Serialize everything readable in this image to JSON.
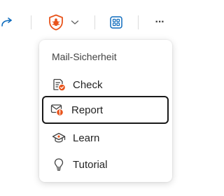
{
  "toolbar": {
    "forward_icon": "arrow-forward-icon",
    "addin_icon": "shield-bug-icon",
    "dropdown_icon": "chevron-down-icon",
    "apps_icon": "apps-grid-icon",
    "more_label": "···"
  },
  "menu": {
    "header": "Mail-Sicherheit",
    "items": [
      {
        "label": "Check",
        "icon": "mail-check-icon"
      },
      {
        "label": "Report",
        "icon": "mail-report-icon"
      },
      {
        "label": "Learn",
        "icon": "graduation-cap-icon"
      },
      {
        "label": "Tutorial",
        "icon": "lightbulb-icon"
      }
    ],
    "focused_index": 1
  },
  "colors": {
    "accent_blue": "#0f6cbd",
    "alert_orange": "#e8541c",
    "focus_border": "#1a1a1a"
  }
}
